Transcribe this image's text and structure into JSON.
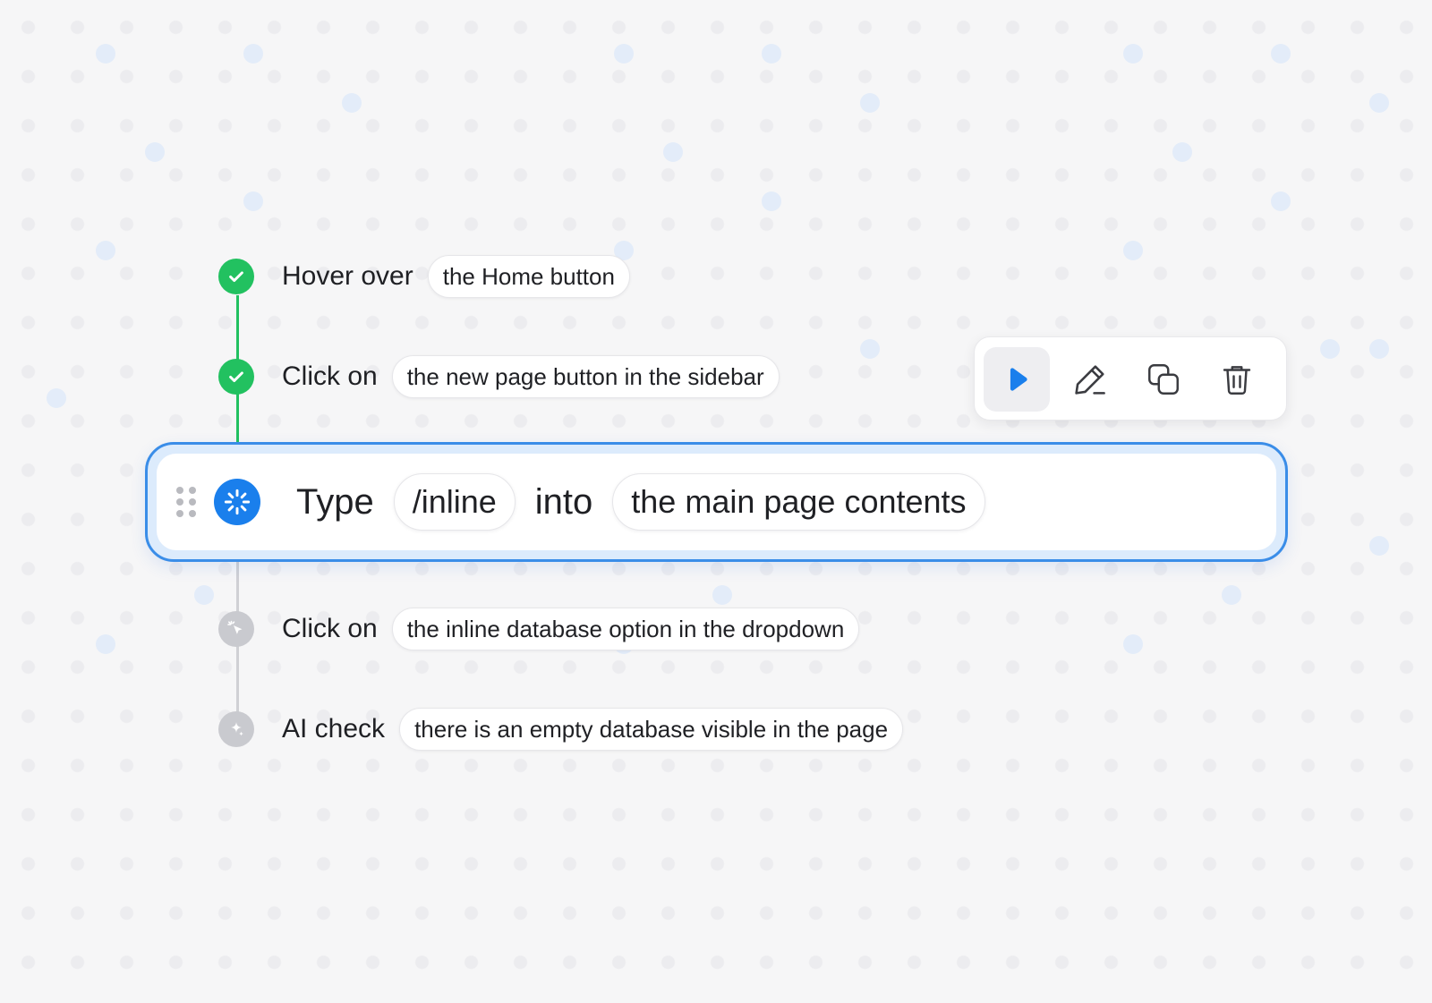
{
  "steps": [
    {
      "action": "Hover over",
      "target": "the Home button",
      "status": "done",
      "icon": "check-icon"
    },
    {
      "action": "Click on",
      "target": "the new page button in the sidebar",
      "status": "done",
      "icon": "check-icon"
    },
    {
      "action": "Type",
      "value": "/inline",
      "connector": "into",
      "target": "the main page contents",
      "status": "running",
      "icon": "spinner-icon"
    },
    {
      "action": "Click on",
      "target": "the inline database option in the dropdown",
      "status": "pending",
      "icon": "cursor-click-icon"
    },
    {
      "action": "AI check",
      "target": "there is an empty database visible in the page",
      "status": "pending",
      "icon": "sparkle-icon"
    }
  ],
  "toolbar": {
    "buttons": [
      {
        "icon": "play-icon",
        "active": true
      },
      {
        "icon": "pencil-icon",
        "active": false
      },
      {
        "icon": "duplicate-icon",
        "active": false
      },
      {
        "icon": "trash-icon",
        "active": false
      }
    ]
  },
  "colors": {
    "success": "#22c160",
    "accent": "#1a7fec",
    "pending": "#c9cacf",
    "background": "#f6f6f7"
  }
}
